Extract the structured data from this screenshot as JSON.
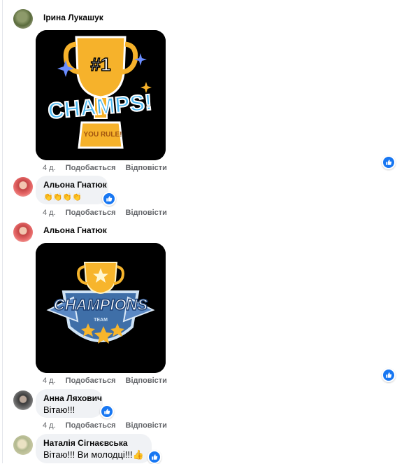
{
  "comments": [
    {
      "author": "Ірина Лукашук",
      "time": "4 д.",
      "like": "Подобається",
      "reply": "Відповісти",
      "sticker_text": [
        "#1",
        "CHAMPS!",
        "YOU RULE!"
      ]
    },
    {
      "author": "Альона Гнатюк",
      "emoji_text": "👏👏👏👏",
      "time": "4 д.",
      "like": "Подобається",
      "reply": "Відповісти"
    },
    {
      "author": "Альона Гнатюк",
      "time": "4 д.",
      "like": "Подобається",
      "reply": "Відповісти",
      "sticker_text": [
        "CHAMPIONS",
        "TEAM"
      ]
    },
    {
      "author": "Анна Ляхович",
      "text": "Вітаю!!!",
      "time": "4 д.",
      "like": "Подобається",
      "reply": "Відповісти"
    },
    {
      "author": "Наталія Сігнаєвська",
      "text": "Вітаю!!! Ви молодці!!!👍"
    }
  ],
  "colors": {
    "like_blue": "#1877f2",
    "bubble_bg": "#f0f2f5",
    "meta_gray": "#65676b"
  },
  "icons": [
    "like-reaction-icon",
    "avatar"
  ]
}
